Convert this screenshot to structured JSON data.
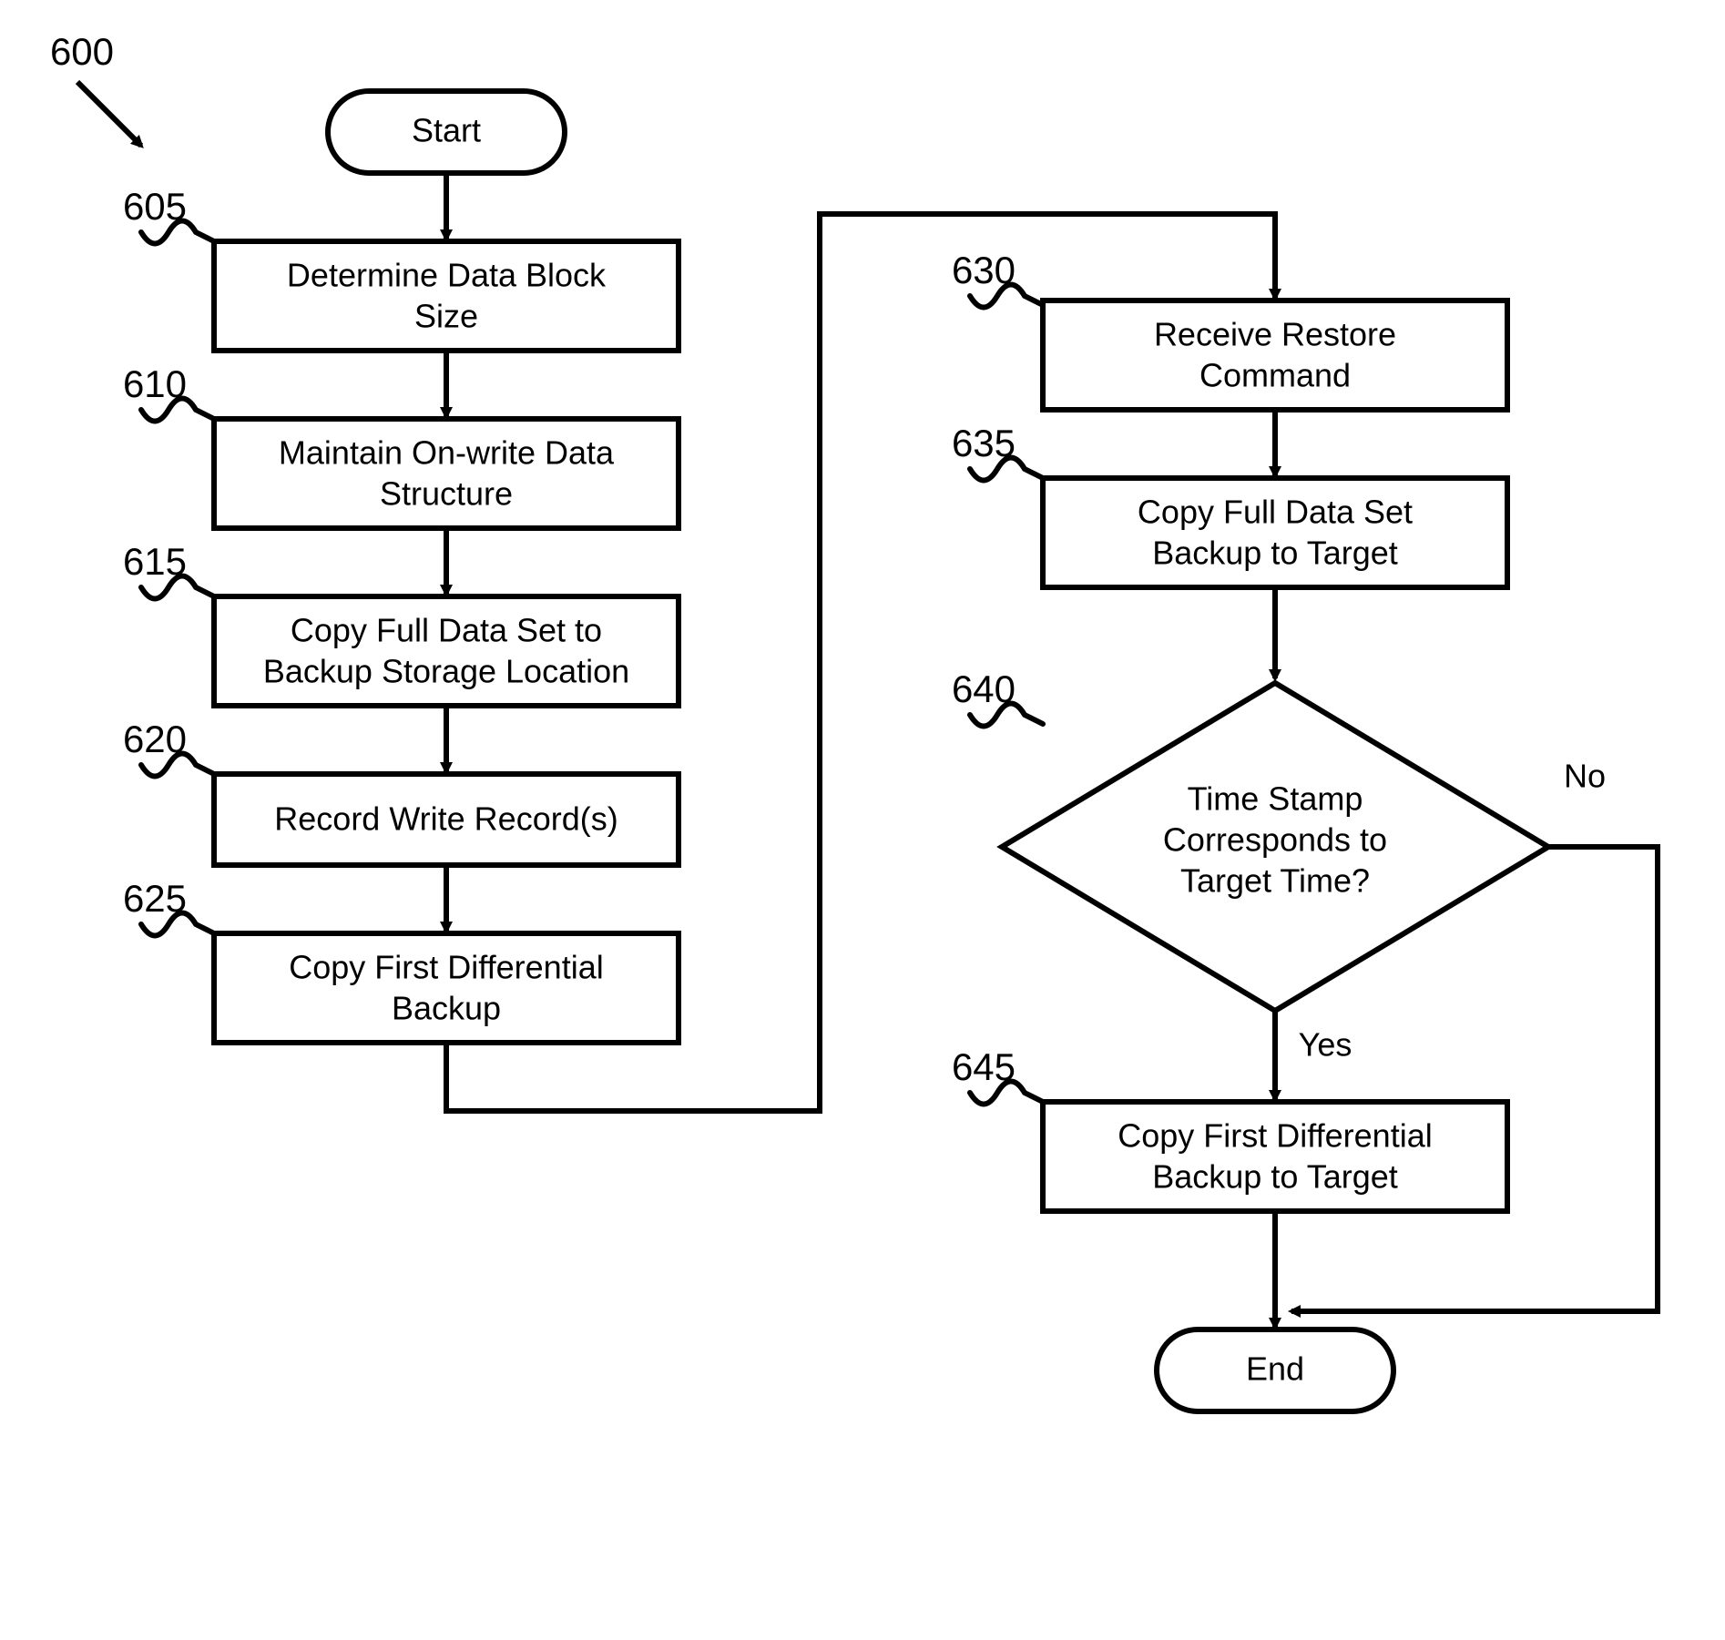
{
  "figure_ref": "600",
  "nodes": {
    "start": {
      "ref": "",
      "text": "Start"
    },
    "n605": {
      "ref": "605",
      "lines": [
        "Determine Data Block",
        "Size"
      ]
    },
    "n610": {
      "ref": "610",
      "lines": [
        "Maintain On-write Data",
        "Structure"
      ]
    },
    "n615": {
      "ref": "615",
      "lines": [
        "Copy Full Data Set to",
        "Backup Storage Location"
      ]
    },
    "n620": {
      "ref": "620",
      "lines": [
        "Record Write Record(s)"
      ]
    },
    "n625": {
      "ref": "625",
      "lines": [
        "Copy First Differential",
        "Backup"
      ]
    },
    "n630": {
      "ref": "630",
      "lines": [
        "Receive Restore",
        "Command"
      ]
    },
    "n635": {
      "ref": "635",
      "lines": [
        "Copy Full Data Set",
        "Backup to Target"
      ]
    },
    "n640": {
      "ref": "640",
      "lines": [
        "Time Stamp",
        "Corresponds to",
        "Target Time?"
      ],
      "yes": "Yes",
      "no": "No"
    },
    "n645": {
      "ref": "645",
      "lines": [
        "Copy First Differential",
        "Backup to Target"
      ]
    },
    "end": {
      "ref": "",
      "text": "End"
    }
  },
  "flow_edges": [
    [
      "start",
      "n605"
    ],
    [
      "n605",
      "n610"
    ],
    [
      "n610",
      "n615"
    ],
    [
      "n615",
      "n620"
    ],
    [
      "n620",
      "n625"
    ],
    [
      "n625",
      "n630"
    ],
    [
      "n630",
      "n635"
    ],
    [
      "n635",
      "n640"
    ],
    [
      "n640.yes",
      "n645"
    ],
    [
      "n640.no",
      "end"
    ],
    [
      "n645",
      "end"
    ]
  ]
}
